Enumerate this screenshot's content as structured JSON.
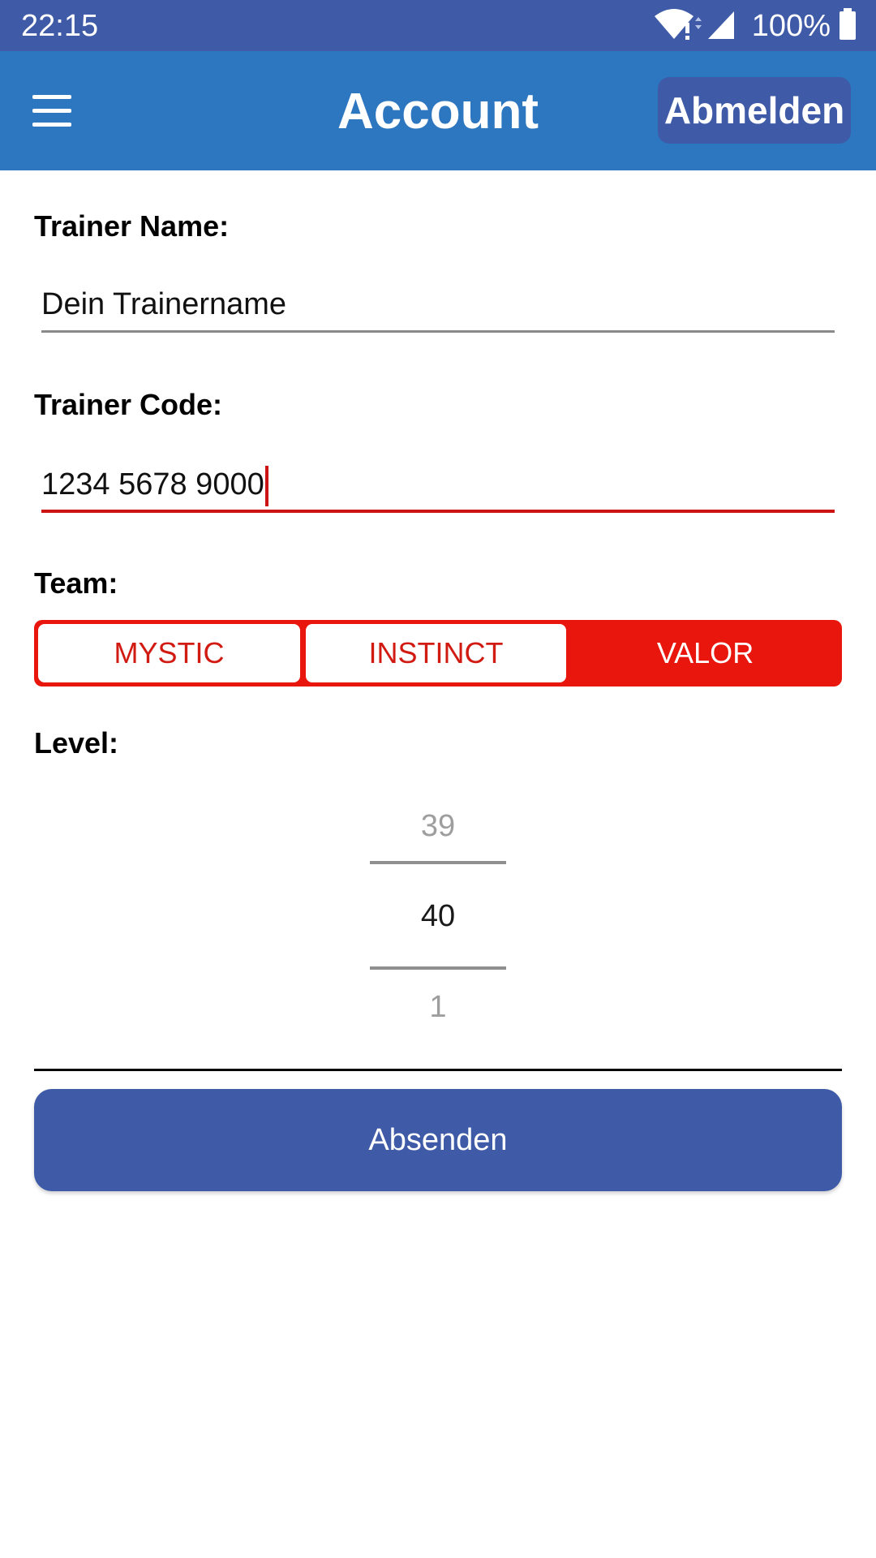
{
  "status_bar": {
    "time": "22:15",
    "battery": "100%",
    "icons": [
      "wifi-alert-icon",
      "signal-icon",
      "battery-icon"
    ]
  },
  "app_bar": {
    "menu_icon": "hamburger-menu-icon",
    "title": "Account",
    "logout_label": "Abmelden"
  },
  "form": {
    "trainer_name": {
      "label": "Trainer Name:",
      "value": "Dein Trainername"
    },
    "trainer_code": {
      "label": "Trainer Code:",
      "value": "1234 5678 9000"
    },
    "team": {
      "label": "Team:",
      "options": [
        "MYSTIC",
        "INSTINCT",
        "VALOR"
      ],
      "selected": "VALOR"
    },
    "level": {
      "label": "Level:",
      "previous": "39",
      "current": "40",
      "next": "1"
    },
    "submit_label": "Absenden"
  },
  "colors": {
    "status_bar": "#3f5ba7",
    "app_bar": "#2d77c0",
    "accent_red": "#e8160d",
    "button_blue": "#3f5ba7"
  }
}
